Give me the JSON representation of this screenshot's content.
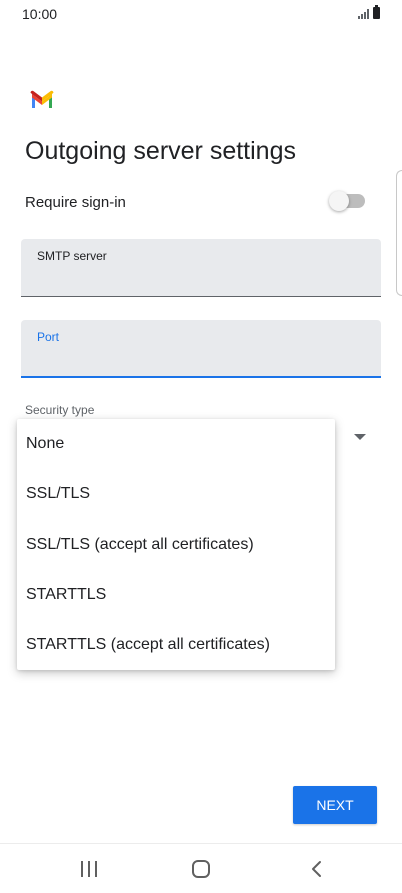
{
  "status_bar": {
    "time": "10:00",
    "signal_icon": "signal-icon",
    "battery_icon": "battery-icon"
  },
  "app_logo": "gmail-logo",
  "page_title": "Outgoing server settings",
  "require_signin": {
    "label": "Require sign-in",
    "enabled": false
  },
  "smtp_server": {
    "label": "SMTP server",
    "value": ""
  },
  "port": {
    "label": "Port",
    "value": ""
  },
  "security_type": {
    "label": "Security type",
    "options": [
      "None",
      "SSL/TLS",
      "SSL/TLS (accept all certificates)",
      "STARTTLS",
      "STARTTLS (accept all certificates)"
    ]
  },
  "next_button": "NEXT",
  "colors": {
    "accent": "#1a73e8",
    "field_bg": "#e8eaed"
  },
  "nav_bar": {
    "recents_icon": "recents-icon",
    "home_icon": "home-icon",
    "back_icon": "back-icon"
  }
}
